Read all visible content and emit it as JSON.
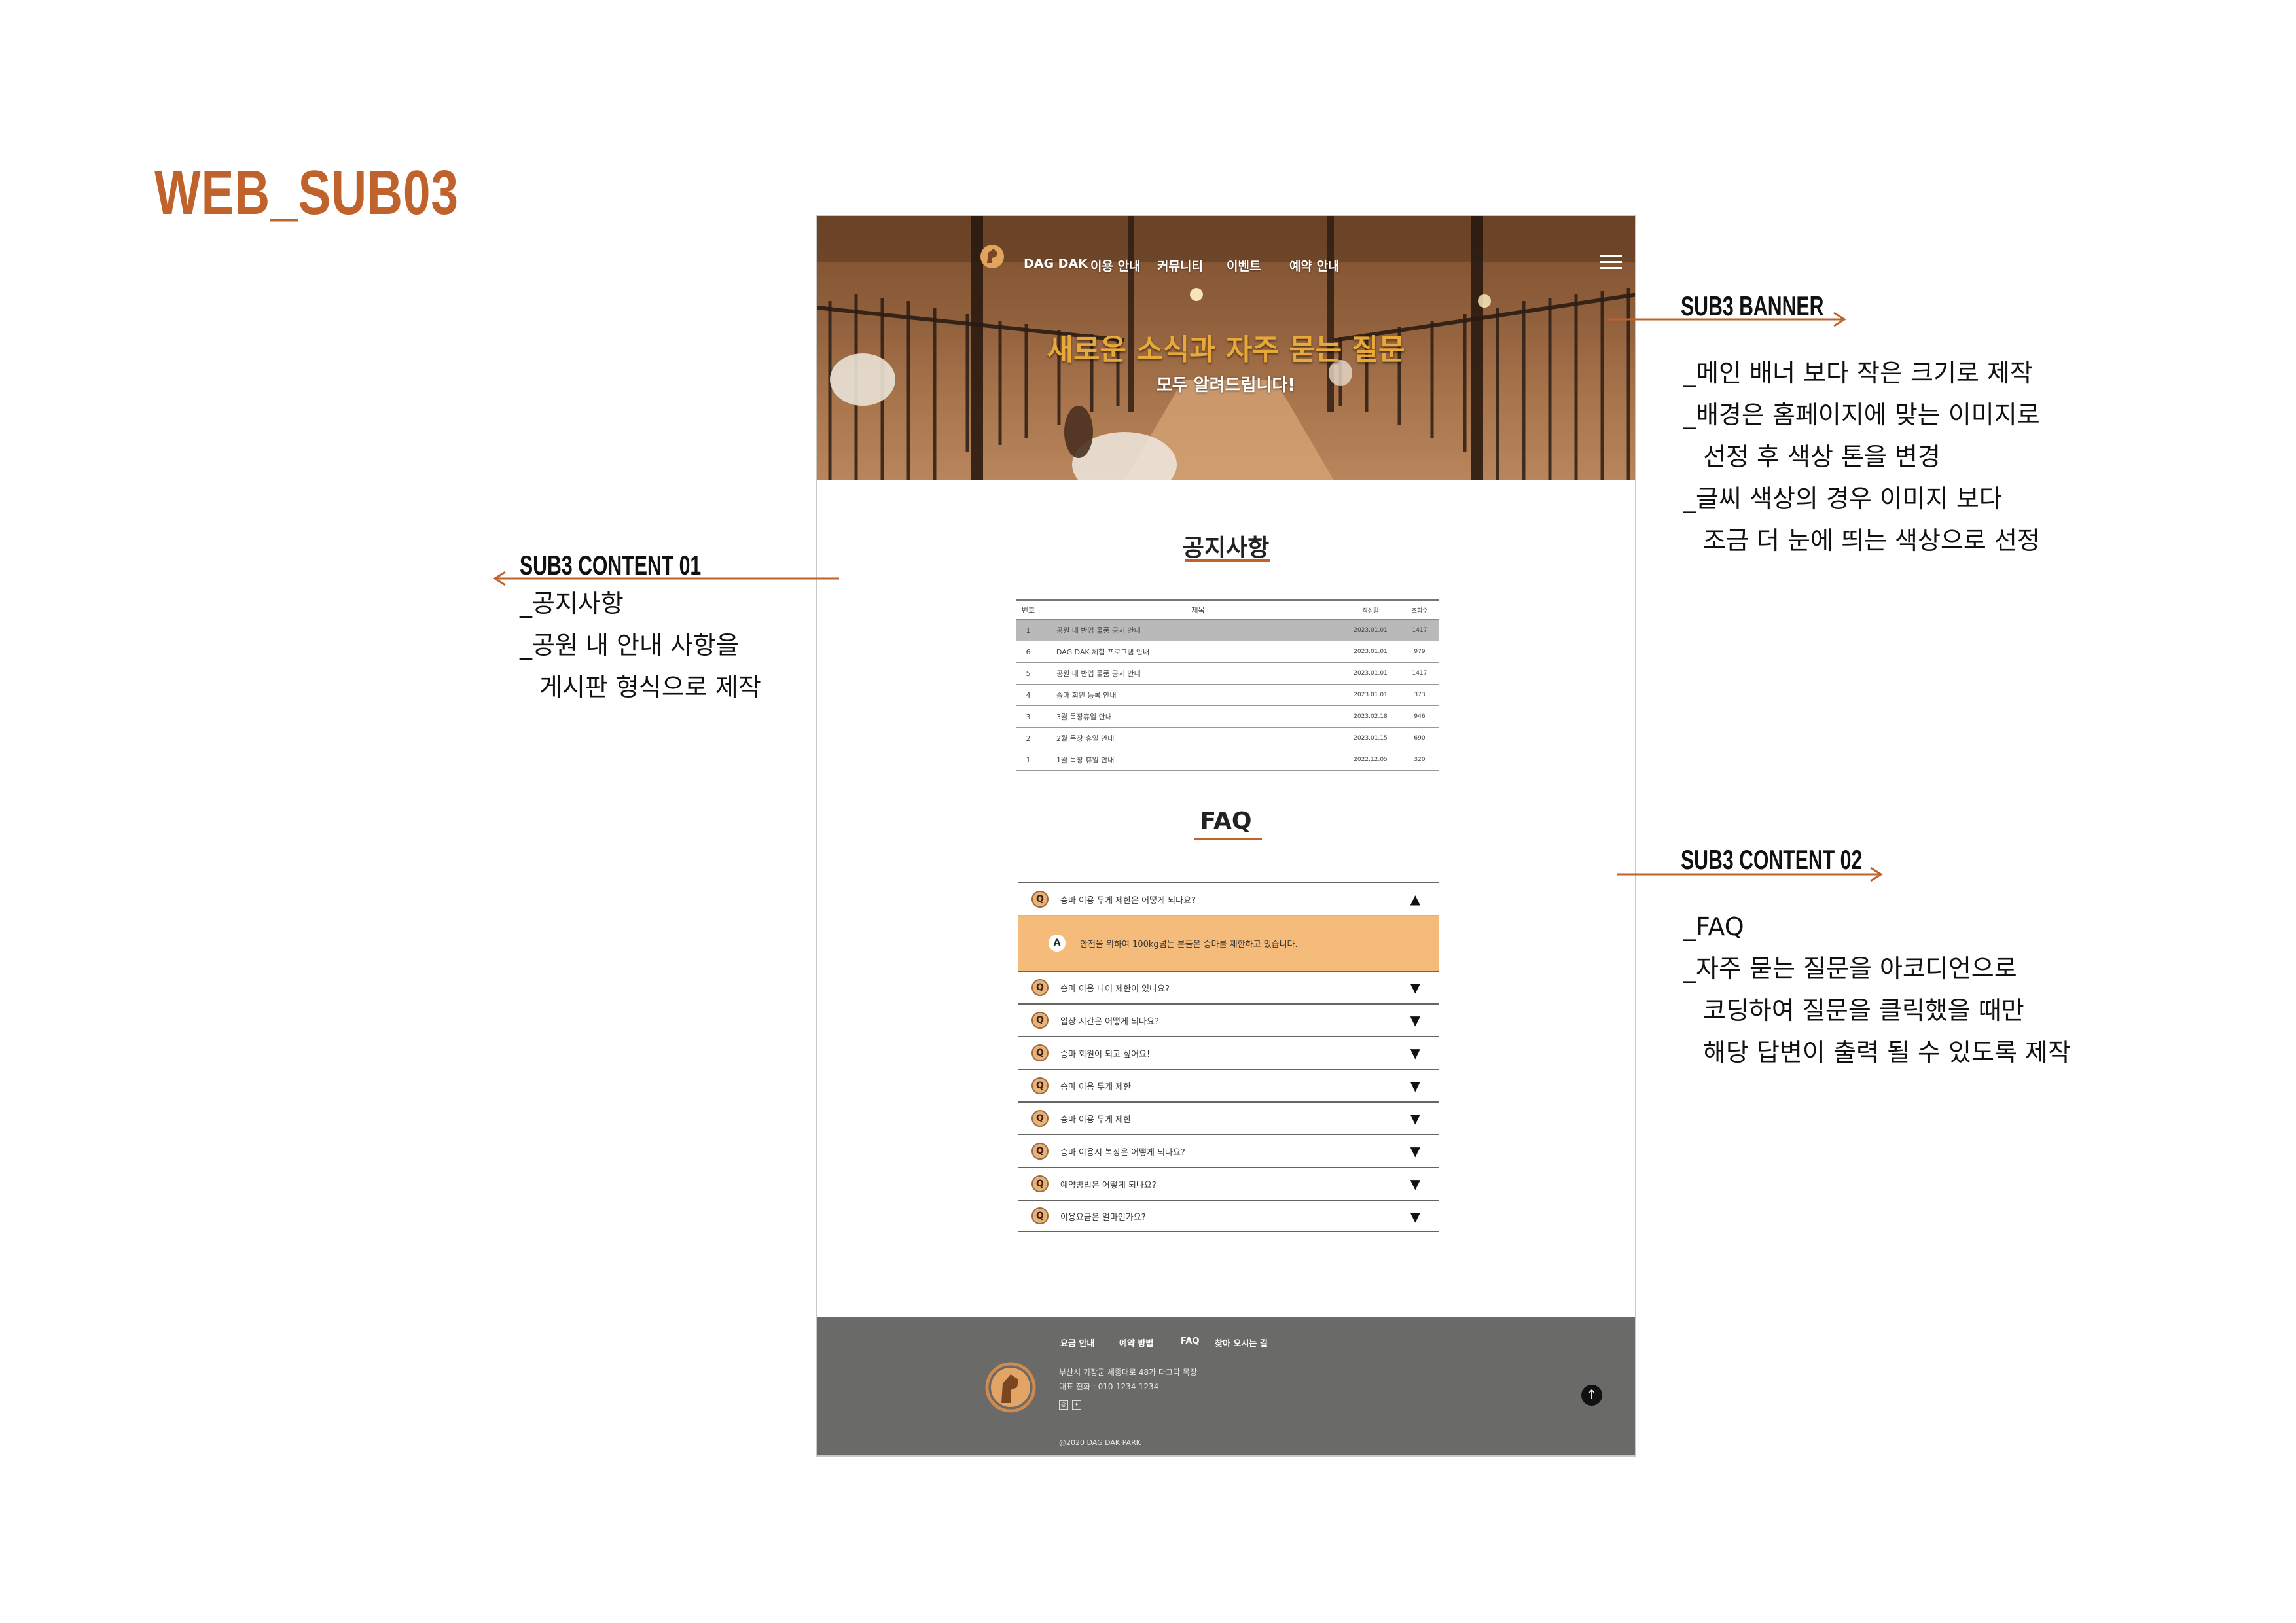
{
  "page_title": "WEB_SUB03",
  "site": {
    "nav": [
      "DAG DAK",
      "이용 안내",
      "커뮤니티",
      "이벤트",
      "예약 안내"
    ],
    "banner": {
      "title": "새로운 소식과 자주 묻는 질문",
      "subtitle": "모두 알려드립니다!"
    },
    "notice": {
      "title": "공지사항",
      "columns": [
        "번호",
        "제목",
        "작성일",
        "조회수"
      ],
      "rows": [
        [
          "1",
          "공원 내 반입 물품 공지 안내",
          "2023.01.01",
          "1417"
        ],
        [
          "6",
          "DAG DAK 체험 프로그램 안내",
          "2023.01.01",
          "979"
        ],
        [
          "5",
          "공원 내 반입 물품 공지 안내",
          "2023.01.01",
          "1417"
        ],
        [
          "4",
          "승마 회원 등록 안내",
          "2023.01.01",
          "373"
        ],
        [
          "3",
          "3월 목장휴일 안내",
          "2023.02.18",
          "946"
        ],
        [
          "2",
          "2월 목장 휴일 안내",
          "2023.01.15",
          "690"
        ],
        [
          "1",
          "1월 목장 휴일 안내",
          "2022.12.05",
          "320"
        ]
      ]
    },
    "faq": {
      "title": "FAQ",
      "q_letter": "Q",
      "a_letter": "A",
      "open": {
        "question": "승마 이용 무게 제한은 어떻게 되나요?",
        "answer": "안전을 위하여 100kg넘는 분들은 승마를 제한하고 있습니다.",
        "arrow": "▲"
      },
      "items": [
        "승마 이용 나이 제한이 있나요?",
        "입장 시간은 어떻게 되나요?",
        "승마 회원이 되고 싶어요!",
        "승마 이용 무게 제한",
        "승마 이용 무게 제한",
        "승마 이용시 복장은 어떻게 되나요?",
        "예약방법은 어떻게 되나요?",
        "이용요금은 얼마인가요?"
      ],
      "closed_arrow": "▼"
    },
    "footer": {
      "links": [
        "요금 안내",
        "예약 방법",
        "FAQ",
        "찾아 오시는 길"
      ],
      "address": "부산시 기장군 세종대로 48가 다그닥 목장",
      "phone": "대표 전화 : 010-1234-1234",
      "copyright": "@2020 DAG DAK PARK",
      "top_button": "↑"
    }
  },
  "annotations": {
    "banner": {
      "title": "SUB3 BANNER",
      "lines": [
        "_메인 배너 보다 작은 크기로 제작",
        "_배경은 홈페이지에 맞는 이미지로",
        "선정 후 색상 톤을 변경",
        "_글씨 색상의 경우 이미지 보다",
        "조금 더 눈에 띄는 색상으로 선정"
      ]
    },
    "content01": {
      "title": "SUB3 CONTENT 01",
      "lines": [
        "_공지사항",
        "_공원 내 안내 사항을",
        "게시판 형식으로 제작"
      ]
    },
    "content02": {
      "title": "SUB3 CONTENT 02",
      "lines": [
        "_FAQ",
        "_자주 묻는 질문을 아코디언으로",
        "코딩하여 질문을 클릭했을 때만",
        "해당 답변이 출력 될 수 있도록 제작"
      ]
    }
  },
  "colors": {
    "accent": "#c0622b",
    "banner_title": "#e8a83a",
    "answer_bg": "#f4bb7a",
    "footer_bg": "#6a6a68"
  }
}
